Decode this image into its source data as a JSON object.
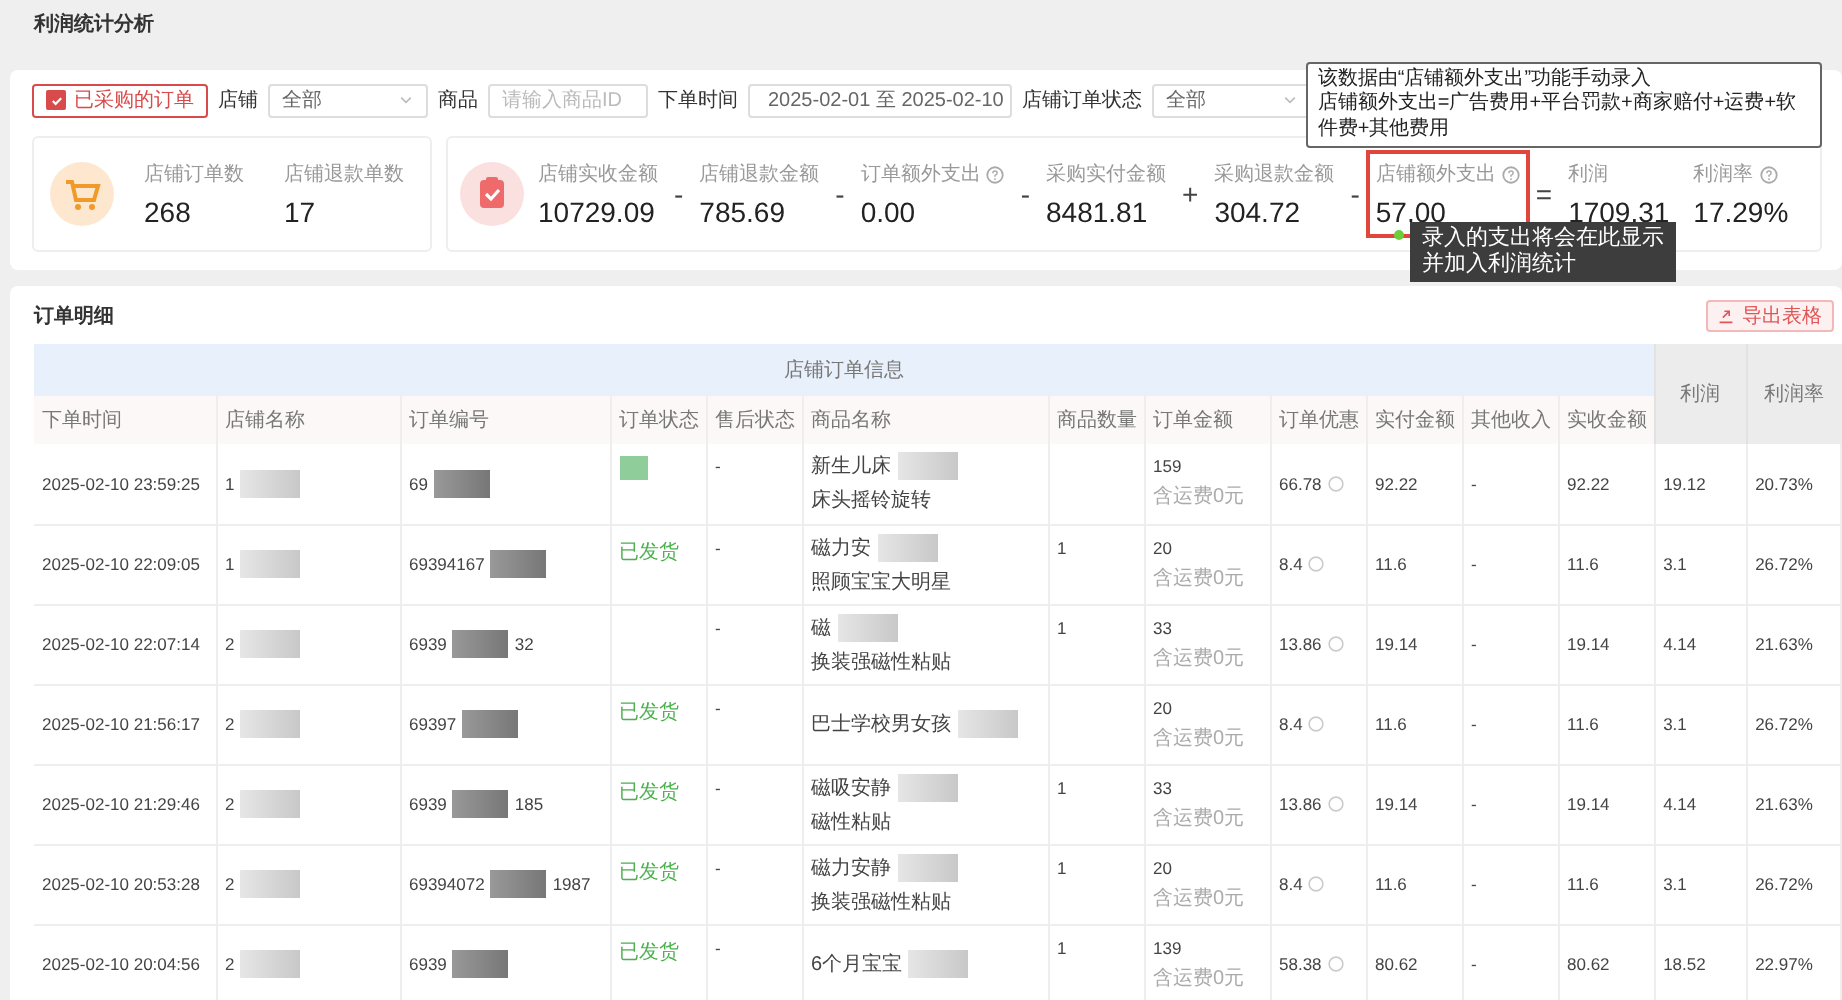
{
  "page_title": "利润统计分析",
  "filters": [
    {
      "kind": "checkbox",
      "label": "已采购的订单",
      "checked": true
    },
    {
      "kind": "select",
      "label": "店铺",
      "value": "全部"
    },
    {
      "kind": "input",
      "label": "商品",
      "placeholder": "请输入商品ID"
    },
    {
      "kind": "daterange",
      "label": "下单时间",
      "value": "2025-02-01 至 2025-02-10"
    },
    {
      "kind": "select",
      "label": "店铺订单状态",
      "value": "全部"
    }
  ],
  "order_stats": [
    {
      "label": "店铺订单数",
      "value": "268"
    },
    {
      "label": "店铺退款单数",
      "value": "17"
    }
  ],
  "amount_stats": [
    {
      "kind": "plain",
      "label": "店铺实收金额",
      "value": "10729.09",
      "operator": "-"
    },
    {
      "kind": "plain",
      "label": "店铺退款金额",
      "value": "785.69",
      "operator": "-"
    },
    {
      "kind": "help",
      "label": "订单额外支出",
      "value": "0.00",
      "operator": "-"
    },
    {
      "kind": "plain",
      "label": "采购实付金额",
      "value": "8481.81",
      "operator": "+"
    },
    {
      "kind": "plain",
      "label": "采购退款金额",
      "value": "304.72",
      "operator": "-"
    },
    {
      "kind": "manual",
      "label": "店铺额外支出",
      "value": "57.00",
      "operator": "="
    },
    {
      "kind": "plain",
      "label": "利润",
      "value": "1709.31"
    },
    {
      "kind": "help",
      "label": "利润率",
      "value": "17.29%"
    }
  ],
  "tooltips": {
    "formula": [
      "该数据由“店铺额外支出”功能手动录入",
      "店铺额外支出=广告费用+平台罚款+商家赔付+运费+软件费+其他费用"
    ],
    "hint": [
      "录入的支出将会在此显示",
      "并加入利润统计"
    ]
  },
  "orders": {
    "title": "订单明细",
    "export_button": "导出表格",
    "group_header": "店铺订单信息",
    "columns": [
      "下单时间",
      "店铺名称",
      "订单编号",
      "订单状态",
      "售后状态",
      "商品名称",
      "商品数量",
      "订单金额",
      "订单优惠",
      "实付金额",
      "其他收入",
      "实收金额"
    ],
    "summary_columns": [
      "利润",
      "利润率"
    ],
    "rows": [
      {
        "time": "2025-02-10 23:59:25",
        "store": "1",
        "order_no": "69",
        "status_masked": true,
        "after_sale": "-",
        "product": [
          "新生儿床",
          "床头摇铃旋转"
        ],
        "amount": "159",
        "shipping": "含运费0元",
        "discount": "66.78",
        "paid": "92.22",
        "other": "-",
        "received": "92.22",
        "profit": "19.12",
        "rate": "20.73%"
      },
      {
        "time": "2025-02-10 22:09:05",
        "store": "1",
        "order_no": "69394167",
        "status": "已发货",
        "status_masked": false,
        "after_sale": "-",
        "product": [
          "磁力安",
          "照顾宝宝大明星"
        ],
        "qty": "1",
        "amount": "20",
        "shipping": "含运费0元",
        "discount": "8.4",
        "paid": "11.6",
        "other": "-",
        "received": "11.6",
        "profit": "3.1",
        "rate": "26.72%"
      },
      {
        "time": "2025-02-10 22:07:14",
        "store": "2",
        "order_no": "6939",
        "order_tail": "32",
        "status_masked": false,
        "after_sale": "-",
        "product": [
          "磁",
          "换装强磁性粘贴"
        ],
        "qty": "1",
        "amount": "33",
        "shipping": "含运费0元",
        "discount": "13.86",
        "paid": "19.14",
        "other": "-",
        "received": "19.14",
        "profit": "4.14",
        "rate": "21.63%"
      },
      {
        "time": "2025-02-10 21:56:17",
        "store": "2",
        "order_no": "69397",
        "status": "已发货",
        "status_masked": false,
        "after_sale": "-",
        "product": [
          "巴士学校男女孩"
        ],
        "amount": "20",
        "shipping": "含运费0元",
        "discount": "8.4",
        "paid": "11.6",
        "other": "-",
        "received": "11.6",
        "profit": "3.1",
        "rate": "26.72%"
      },
      {
        "time": "2025-02-10 21:29:46",
        "store": "2",
        "order_no": "6939",
        "order_tail": "185",
        "status": "已发货",
        "status_masked": false,
        "after_sale": "-",
        "product": [
          "磁吸安静",
          "磁性粘贴"
        ],
        "qty": "1",
        "amount": "33",
        "shipping": "含运费0元",
        "discount": "13.86",
        "paid": "19.14",
        "other": "-",
        "received": "19.14",
        "profit": "4.14",
        "rate": "21.63%"
      },
      {
        "time": "2025-02-10 20:53:28",
        "store": "2",
        "order_no": "69394072",
        "order_tail": "1987",
        "status": "已发货",
        "status_masked": false,
        "after_sale": "-",
        "product": [
          "磁力安静",
          "换装强磁性粘贴"
        ],
        "qty": "1",
        "amount": "20",
        "shipping": "含运费0元",
        "discount": "8.4",
        "paid": "11.6",
        "other": "-",
        "received": "11.6",
        "profit": "3.1",
        "rate": "26.72%"
      },
      {
        "time": "2025-02-10 20:04:56",
        "store": "2",
        "order_no": "6939",
        "status": "已发货",
        "status_masked": false,
        "after_sale": "-",
        "product": [
          "6个月宝宝"
        ],
        "qty": "1",
        "amount": "139",
        "shipping": "含运费0元",
        "discount": "58.38",
        "paid": "80.62",
        "other": "-",
        "received": "80.62",
        "profit": "18.52",
        "rate": "22.97%"
      }
    ]
  }
}
